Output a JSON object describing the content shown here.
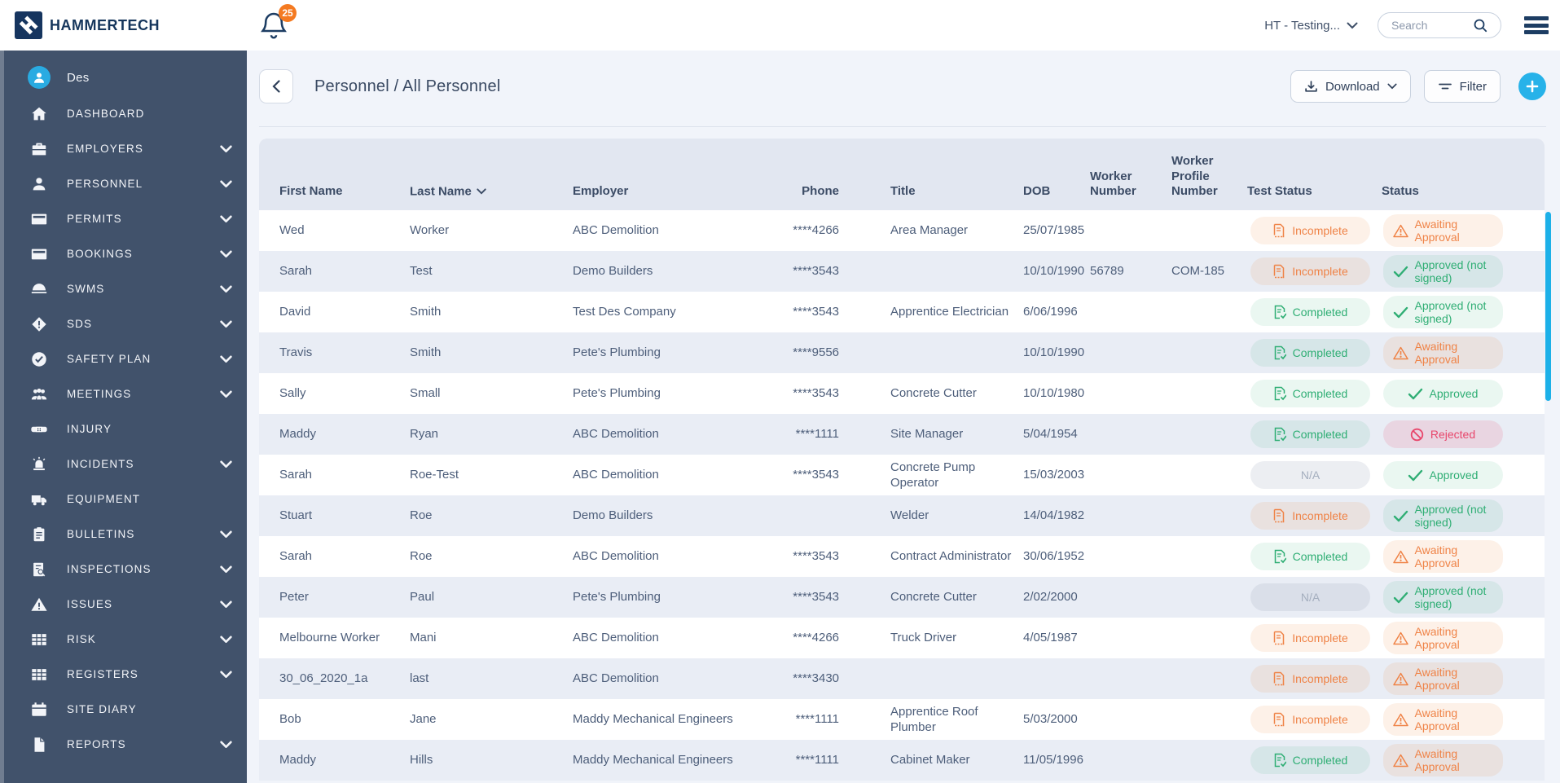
{
  "brand": {
    "name": "HAMMERTECH"
  },
  "topbar": {
    "notification_count": "25",
    "org_selector": "HT - Testing...",
    "search_placeholder": "Search"
  },
  "sidebar": {
    "user": "Des",
    "items": [
      {
        "label": "DASHBOARD",
        "icon": "home-icon",
        "expandable": false
      },
      {
        "label": "EMPLOYERS",
        "icon": "briefcase-icon",
        "expandable": true
      },
      {
        "label": "PERSONNEL",
        "icon": "person-icon",
        "expandable": true
      },
      {
        "label": "PERMITS",
        "icon": "card-icon",
        "expandable": true
      },
      {
        "label": "BOOKINGS",
        "icon": "card-icon",
        "expandable": true
      },
      {
        "label": "SWMS",
        "icon": "helmet-icon",
        "expandable": true
      },
      {
        "label": "SDS",
        "icon": "diamond-alert-icon",
        "expandable": true
      },
      {
        "label": "SAFETY PLAN",
        "icon": "check-circle-icon",
        "expandable": true
      },
      {
        "label": "MEETINGS",
        "icon": "people-icon",
        "expandable": true
      },
      {
        "label": "INJURY",
        "icon": "bandage-icon",
        "expandable": false
      },
      {
        "label": "INCIDENTS",
        "icon": "siren-icon",
        "expandable": true
      },
      {
        "label": "EQUIPMENT",
        "icon": "truck-icon",
        "expandable": false
      },
      {
        "label": "BULLETINS",
        "icon": "clipboard-icon",
        "expandable": true
      },
      {
        "label": "INSPECTIONS",
        "icon": "doc-search-icon",
        "expandable": true
      },
      {
        "label": "ISSUES",
        "icon": "warning-icon",
        "expandable": true
      },
      {
        "label": "RISK",
        "icon": "grid-icon",
        "expandable": true
      },
      {
        "label": "REGISTERS",
        "icon": "grid-icon",
        "expandable": true
      },
      {
        "label": "SITE DIARY",
        "icon": "calendar-icon",
        "expandable": false
      },
      {
        "label": "REPORTS",
        "icon": "file-icon",
        "expandable": true
      }
    ]
  },
  "toolbar": {
    "breadcrumb": "Personnel / All Personnel",
    "download_label": "Download",
    "filter_label": "Filter"
  },
  "table": {
    "columns": [
      "First Name",
      "Last Name",
      "Employer",
      "Phone",
      "Title",
      "DOB",
      "Worker Number",
      "Worker Profile Number",
      "Test Status",
      "Status"
    ],
    "sorted_column": "Last Name",
    "rows": [
      {
        "first_name": "Wed",
        "last_name": "Worker",
        "employer": "ABC Demolition",
        "phone": "****4266",
        "title": "Area Manager",
        "dob": "25/07/1985",
        "worker_number": "",
        "worker_profile_number": "",
        "test_status": {
          "label": "Incomplete",
          "type": "incomplete"
        },
        "status": {
          "label": "Awaiting Approval",
          "type": "awaiting"
        }
      },
      {
        "first_name": "Sarah",
        "last_name": "Test",
        "employer": "Demo Builders",
        "phone": "****3543",
        "title": "",
        "dob": "10/10/1990",
        "worker_number": "56789",
        "worker_profile_number": "COM-185",
        "test_status": {
          "label": "Incomplete",
          "type": "incomplete"
        },
        "status": {
          "label": "Approved (not signed)",
          "type": "approved_ns"
        }
      },
      {
        "first_name": "David",
        "last_name": "Smith",
        "employer": "Test Des Company",
        "phone": "****3543",
        "title": "Apprentice Electrician",
        "dob": "6/06/1996",
        "worker_number": "",
        "worker_profile_number": "",
        "test_status": {
          "label": "Completed",
          "type": "completed"
        },
        "status": {
          "label": "Approved (not signed)",
          "type": "approved_ns"
        }
      },
      {
        "first_name": "Travis",
        "last_name": "Smith",
        "employer": "Pete's Plumbing",
        "phone": "****9556",
        "title": "",
        "dob": "10/10/1990",
        "worker_number": "",
        "worker_profile_number": "",
        "test_status": {
          "label": "Completed",
          "type": "completed"
        },
        "status": {
          "label": "Awaiting Approval",
          "type": "awaiting"
        }
      },
      {
        "first_name": "Sally",
        "last_name": "Small",
        "employer": "Pete's Plumbing",
        "phone": "****3543",
        "title": "Concrete Cutter",
        "dob": "10/10/1980",
        "worker_number": "",
        "worker_profile_number": "",
        "test_status": {
          "label": "Completed",
          "type": "completed"
        },
        "status": {
          "label": "Approved",
          "type": "approved"
        }
      },
      {
        "first_name": "Maddy",
        "last_name": "Ryan",
        "employer": "ABC Demolition",
        "phone": "****1111",
        "title": "Site Manager",
        "dob": "5/04/1954",
        "worker_number": "",
        "worker_profile_number": "",
        "test_status": {
          "label": "Completed",
          "type": "completed"
        },
        "status": {
          "label": "Rejected",
          "type": "rejected"
        }
      },
      {
        "first_name": "Sarah",
        "last_name": "Roe-Test",
        "employer": "ABC Demolition",
        "phone": "****3543",
        "title": "Concrete Pump Operator",
        "dob": "15/03/2003",
        "worker_number": "",
        "worker_profile_number": "",
        "test_status": {
          "label": "N/A",
          "type": "na"
        },
        "status": {
          "label": "Approved",
          "type": "approved"
        }
      },
      {
        "first_name": "Stuart",
        "last_name": "Roe",
        "employer": "Demo Builders",
        "phone": "",
        "title": "Welder",
        "dob": "14/04/1982",
        "worker_number": "",
        "worker_profile_number": "",
        "test_status": {
          "label": "Incomplete",
          "type": "incomplete"
        },
        "status": {
          "label": "Approved (not signed)",
          "type": "approved_ns"
        }
      },
      {
        "first_name": "Sarah",
        "last_name": "Roe",
        "employer": "ABC Demolition",
        "phone": "****3543",
        "title": "Contract Administrator",
        "dob": "30/06/1952",
        "worker_number": "",
        "worker_profile_number": "",
        "test_status": {
          "label": "Completed",
          "type": "completed"
        },
        "status": {
          "label": "Awaiting Approval",
          "type": "awaiting"
        }
      },
      {
        "first_name": "Peter",
        "last_name": "Paul",
        "employer": "Pete's Plumbing",
        "phone": "****3543",
        "title": "Concrete Cutter",
        "dob": "2/02/2000",
        "worker_number": "",
        "worker_profile_number": "",
        "test_status": {
          "label": "N/A",
          "type": "na"
        },
        "status": {
          "label": "Approved (not signed)",
          "type": "approved_ns"
        }
      },
      {
        "first_name": "Melbourne Worker",
        "last_name": "Mani",
        "employer": "ABC Demolition",
        "phone": "****4266",
        "title": "Truck Driver",
        "dob": "4/05/1987",
        "worker_number": "",
        "worker_profile_number": "",
        "test_status": {
          "label": "Incomplete",
          "type": "incomplete"
        },
        "status": {
          "label": "Awaiting Approval",
          "type": "awaiting"
        }
      },
      {
        "first_name": "30_06_2020_1a",
        "last_name": "last",
        "employer": "ABC Demolition",
        "phone": "****3430",
        "title": "",
        "dob": "",
        "worker_number": "",
        "worker_profile_number": "",
        "test_status": {
          "label": "Incomplete",
          "type": "incomplete"
        },
        "status": {
          "label": "Awaiting Approval",
          "type": "awaiting"
        }
      },
      {
        "first_name": "Bob",
        "last_name": "Jane",
        "employer": "Maddy Mechanical Engineers",
        "phone": "****1111",
        "title": "Apprentice Roof Plumber",
        "dob": "5/03/2000",
        "worker_number": "",
        "worker_profile_number": "",
        "test_status": {
          "label": "Incomplete",
          "type": "incomplete"
        },
        "status": {
          "label": "Awaiting Approval",
          "type": "awaiting"
        }
      },
      {
        "first_name": "Maddy",
        "last_name": "Hills",
        "employer": "Maddy Mechanical Engineers",
        "phone": "****1111",
        "title": "Cabinet Maker",
        "dob": "11/05/1996",
        "worker_number": "",
        "worker_profile_number": "",
        "test_status": {
          "label": "Completed",
          "type": "completed"
        },
        "status": {
          "label": "Awaiting Approval",
          "type": "awaiting"
        }
      }
    ]
  },
  "colors": {
    "sidebar_bg": "#41526b",
    "navy": "#16365c",
    "accent_cyan": "#27b2e9",
    "orange": "#ef8347",
    "green": "#2fae74",
    "pink": "#e8466b",
    "badge_orange": "#f47a21",
    "header_row_bg": "#e2e7f1",
    "alt_row_bg": "#e9edf5"
  }
}
